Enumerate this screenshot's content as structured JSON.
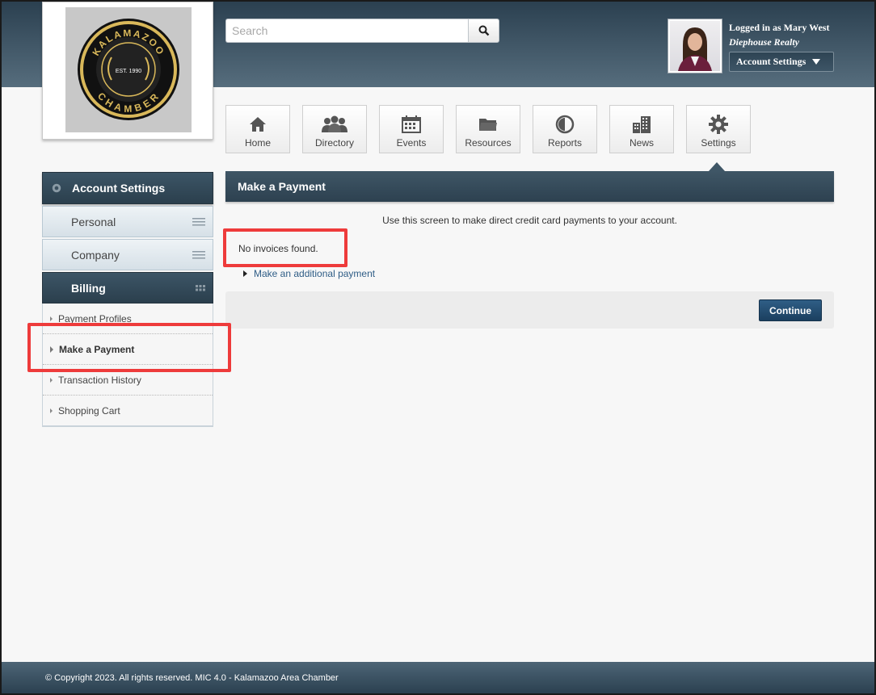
{
  "logo": {
    "top_text": "KALAMAZOO",
    "mid_text": "EST. 1990",
    "bottom_text": "CHAMBER"
  },
  "search": {
    "placeholder": "Search",
    "icon": "search-icon"
  },
  "user": {
    "logged_in": "Logged in as Mary West",
    "company": "Diephouse Realty",
    "account_settings": "Account Settings"
  },
  "nav": {
    "items": [
      {
        "label": "Home",
        "icon": "home-icon"
      },
      {
        "label": "Directory",
        "icon": "people-icon"
      },
      {
        "label": "Events",
        "icon": "calendar-icon"
      },
      {
        "label": "Resources",
        "icon": "folder-icon"
      },
      {
        "label": "Reports",
        "icon": "pie-chart-icon"
      },
      {
        "label": "News",
        "icon": "buildings-icon"
      },
      {
        "label": "Settings",
        "icon": "gear-icon"
      }
    ]
  },
  "sidebar": {
    "header": "Account Settings",
    "sections": [
      {
        "label": "Personal"
      },
      {
        "label": "Company"
      },
      {
        "label": "Billing"
      }
    ],
    "sub_items": [
      {
        "label": "Payment Profiles"
      },
      {
        "label": "Make a Payment"
      },
      {
        "label": "Transaction History"
      },
      {
        "label": "Shopping Cart"
      }
    ]
  },
  "main": {
    "title": "Make a Payment",
    "intro": "Use this screen to make direct credit card payments to your account.",
    "no_invoices": "No invoices found.",
    "additional_payment": "Make an additional payment",
    "continue": "Continue"
  },
  "footer": {
    "copyright": "© Copyright 2023. All rights reserved. MIC 4.0 - Kalamazoo Area Chamber"
  },
  "colors": {
    "header_dark": "#2b4050",
    "accent_blue": "#2f5e86",
    "highlight_red": "#ee3b3b",
    "logo_gold": "#d9b85a"
  }
}
